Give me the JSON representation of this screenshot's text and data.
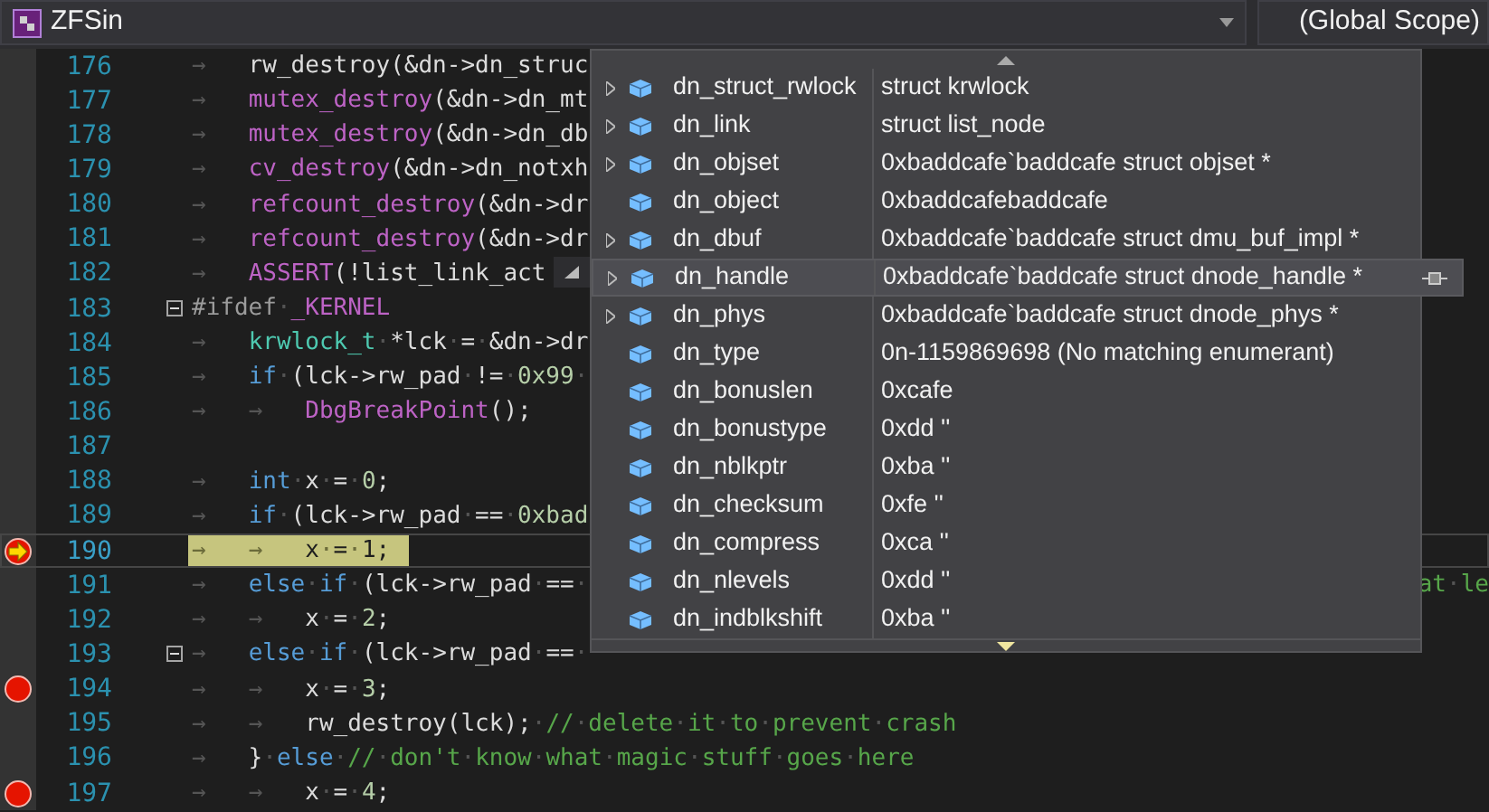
{
  "toolbar": {
    "project": "ZFSin",
    "scope": "(Global Scope)"
  },
  "lines": [
    {
      "number": "176",
      "breakpoint": false,
      "current": false,
      "collapsible": false,
      "tokens": [
        {
          "kind": "plain",
          "text": "→   rw_destroy(&dn->dn_struc"
        }
      ]
    },
    {
      "number": "177",
      "breakpoint": false,
      "current": false,
      "collapsible": false,
      "tokens": [
        {
          "kind": "plain",
          "text": "→   "
        },
        {
          "kind": "function",
          "text": "mutex_destroy"
        },
        {
          "kind": "plain",
          "text": "(&dn->dn_mt"
        }
      ]
    },
    {
      "number": "178",
      "breakpoint": false,
      "current": false,
      "collapsible": false,
      "tokens": [
        {
          "kind": "plain",
          "text": "→   "
        },
        {
          "kind": "function",
          "text": "mutex_destroy"
        },
        {
          "kind": "plain",
          "text": "(&dn->dn_db"
        }
      ]
    },
    {
      "number": "179",
      "breakpoint": false,
      "current": false,
      "collapsible": false,
      "tokens": [
        {
          "kind": "plain",
          "text": "→   "
        },
        {
          "kind": "function",
          "text": "cv_destroy"
        },
        {
          "kind": "plain",
          "text": "(&dn->dn_notxh"
        }
      ]
    },
    {
      "number": "180",
      "breakpoint": false,
      "current": false,
      "collapsible": false,
      "tokens": [
        {
          "kind": "plain",
          "text": "→   "
        },
        {
          "kind": "function",
          "text": "refcount_destroy"
        },
        {
          "kind": "plain",
          "text": "(&dn->dr"
        }
      ]
    },
    {
      "number": "181",
      "breakpoint": false,
      "current": false,
      "collapsible": false,
      "tokens": [
        {
          "kind": "plain",
          "text": "→   "
        },
        {
          "kind": "function",
          "text": "refcount_destroy"
        },
        {
          "kind": "plain",
          "text": "(&dn->dr"
        }
      ]
    },
    {
      "number": "182",
      "breakpoint": false,
      "current": false,
      "collapsible": false,
      "tokens": [
        {
          "kind": "plain",
          "text": "→   "
        },
        {
          "kind": "function",
          "text": "ASSERT"
        },
        {
          "kind": "plain",
          "text": "(!list_link_act"
        }
      ]
    },
    {
      "number": "183",
      "breakpoint": false,
      "current": false,
      "collapsible": true,
      "tokens": [
        {
          "kind": "preprocessor",
          "text": "#ifdef·"
        },
        {
          "kind": "function",
          "text": "_KERNEL"
        }
      ]
    },
    {
      "number": "184",
      "breakpoint": false,
      "current": false,
      "collapsible": false,
      "tokens": [
        {
          "kind": "plain",
          "text": "→   "
        },
        {
          "kind": "type",
          "text": "krwlock_t"
        },
        {
          "kind": "plain",
          "text": "·*lck·=·&dn->dr"
        }
      ]
    },
    {
      "number": "185",
      "breakpoint": false,
      "current": false,
      "collapsible": false,
      "tokens": [
        {
          "kind": "plain",
          "text": "→   "
        },
        {
          "kind": "keyword",
          "text": "if"
        },
        {
          "kind": "plain",
          "text": "·(lck->rw_pad·!=·"
        },
        {
          "kind": "number",
          "text": "0x99"
        },
        {
          "kind": "plain",
          "text": "·"
        }
      ]
    },
    {
      "number": "186",
      "breakpoint": false,
      "current": false,
      "collapsible": false,
      "tokens": [
        {
          "kind": "plain",
          "text": "→   →   "
        },
        {
          "kind": "function",
          "text": "DbgBreakPoint"
        },
        {
          "kind": "plain",
          "text": "();"
        }
      ]
    },
    {
      "number": "187",
      "breakpoint": false,
      "current": false,
      "collapsible": false
    },
    {
      "number": "188",
      "breakpoint": false,
      "current": false,
      "collapsible": false,
      "tokens": [
        {
          "kind": "plain",
          "text": "→   "
        },
        {
          "kind": "keyword",
          "text": "int"
        },
        {
          "kind": "plain",
          "text": "·x·=·"
        },
        {
          "kind": "number",
          "text": "0"
        },
        {
          "kind": "plain",
          "text": ";"
        }
      ]
    },
    {
      "number": "189",
      "breakpoint": false,
      "current": false,
      "collapsible": false,
      "tokens": [
        {
          "kind": "plain",
          "text": "→   "
        },
        {
          "kind": "keyword",
          "text": "if"
        },
        {
          "kind": "plain",
          "text": "·(lck->rw_pad·==·"
        },
        {
          "kind": "number",
          "text": "0xbad"
        }
      ]
    },
    {
      "number": "190",
      "breakpoint": true,
      "current": true,
      "collapsible": false,
      "tokens": [
        {
          "kind": "plain",
          "text": "→   →   x·=·1;"
        }
      ]
    },
    {
      "number": "191",
      "breakpoint": false,
      "current": false,
      "collapsible": false,
      "tokens": [
        {
          "kind": "plain",
          "text": "→   "
        },
        {
          "kind": "keyword",
          "text": "else"
        },
        {
          "kind": "plain",
          "text": "·"
        },
        {
          "kind": "keyword",
          "text": "if"
        },
        {
          "kind": "plain",
          "text": "·(lck->rw_pad·==·"
        }
      ],
      "tokens_right": [
        {
          "kind": "comment",
          "text": "at·le"
        }
      ]
    },
    {
      "number": "192",
      "breakpoint": false,
      "current": false,
      "collapsible": false,
      "tokens": [
        {
          "kind": "plain",
          "text": "→   →   x·=·"
        },
        {
          "kind": "number",
          "text": "2"
        },
        {
          "kind": "plain",
          "text": ";"
        }
      ]
    },
    {
      "number": "193",
      "breakpoint": false,
      "current": false,
      "collapsible": true,
      "tokens": [
        {
          "kind": "plain",
          "text": "→   "
        },
        {
          "kind": "keyword",
          "text": "else"
        },
        {
          "kind": "plain",
          "text": "·"
        },
        {
          "kind": "keyword",
          "text": "if"
        },
        {
          "kind": "plain",
          "text": "·(lck->rw_pad·==·"
        }
      ]
    },
    {
      "number": "194",
      "breakpoint": true,
      "current": false,
      "collapsible": false,
      "tokens": [
        {
          "kind": "plain",
          "text": "→   →   x·=·"
        },
        {
          "kind": "number",
          "text": "3"
        },
        {
          "kind": "plain",
          "text": ";"
        }
      ]
    },
    {
      "number": "195",
      "breakpoint": false,
      "current": false,
      "collapsible": false,
      "tokens": [
        {
          "kind": "plain",
          "text": "→   →   rw_destroy(lck);·"
        },
        {
          "kind": "comment",
          "text": "//·delete·it·to·prevent·crash"
        }
      ]
    },
    {
      "number": "196",
      "breakpoint": false,
      "current": false,
      "collapsible": false,
      "tokens": [
        {
          "kind": "plain",
          "text": "→   }·"
        },
        {
          "kind": "keyword",
          "text": "else"
        },
        {
          "kind": "plain",
          "text": "·"
        },
        {
          "kind": "comment",
          "text": "//·don't·know·what·magic·stuff·goes·here"
        }
      ]
    },
    {
      "number": "197",
      "breakpoint": true,
      "current": false,
      "collapsible": false,
      "tokens": [
        {
          "kind": "plain",
          "text": "→   →   x·=·"
        },
        {
          "kind": "number",
          "text": "4"
        },
        {
          "kind": "plain",
          "text": ";"
        }
      ]
    }
  ],
  "datatip": {
    "rows": [
      {
        "name": "dn_struct_rwlock",
        "value": "struct krwlock",
        "expandable": true,
        "selected": false
      },
      {
        "name": "dn_link",
        "value": "struct list_node",
        "expandable": true,
        "selected": false
      },
      {
        "name": "dn_objset",
        "value": "0xbaddcafe`baddcafe struct objset *",
        "expandable": true,
        "selected": false
      },
      {
        "name": "dn_object",
        "value": "0xbaddcafebaddcafe",
        "expandable": false,
        "selected": false
      },
      {
        "name": "dn_dbuf",
        "value": "0xbaddcafe`baddcafe struct dmu_buf_impl *",
        "expandable": true,
        "selected": false
      },
      {
        "name": "dn_handle",
        "value": "0xbaddcafe`baddcafe struct dnode_handle *",
        "expandable": true,
        "selected": true
      },
      {
        "name": "dn_phys",
        "value": "0xbaddcafe`baddcafe struct dnode_phys *",
        "expandable": true,
        "selected": false
      },
      {
        "name": "dn_type",
        "value": "0n-1159869698 (No matching enumerant)",
        "expandable": false,
        "selected": false
      },
      {
        "name": "dn_bonuslen",
        "value": "0xcafe",
        "expandable": false,
        "selected": false
      },
      {
        "name": "dn_bonustype",
        "value": "0xdd ''",
        "expandable": false,
        "selected": false
      },
      {
        "name": "dn_nblkptr",
        "value": "0xba ''",
        "expandable": false,
        "selected": false
      },
      {
        "name": "dn_checksum",
        "value": "0xfe ''",
        "expandable": false,
        "selected": false
      },
      {
        "name": "dn_compress",
        "value": "0xca ''",
        "expandable": false,
        "selected": false
      },
      {
        "name": "dn_nlevels",
        "value": "0xdd ''",
        "expandable": false,
        "selected": false
      },
      {
        "name": "dn_indblkshift",
        "value": "0xba ''",
        "expandable": false,
        "selected": false
      }
    ]
  }
}
